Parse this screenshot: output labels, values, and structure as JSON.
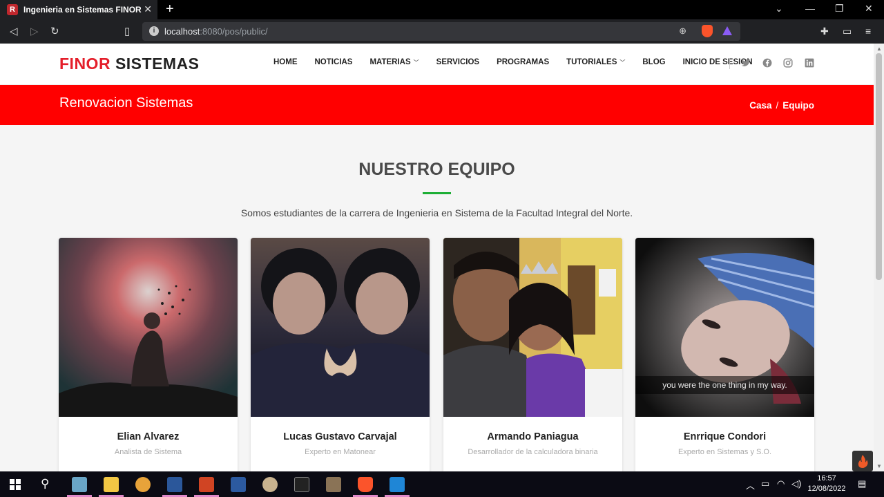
{
  "browser": {
    "tab_title": "Ingenieria en Sistemas FINOR",
    "tab_favicon_letter": "R",
    "url_host": "localhost",
    "url_rest": ":8080/pos/public/"
  },
  "site": {
    "logo_red": "FINOR",
    "logo_dark": "SISTEMAS",
    "menu": [
      {
        "label": "HOME",
        "dropdown": false
      },
      {
        "label": "NOTICIAS",
        "dropdown": false
      },
      {
        "label": "MATERIAS",
        "dropdown": true
      },
      {
        "label": "SERVICIOS",
        "dropdown": false
      },
      {
        "label": "PROGRAMAS",
        "dropdown": false
      },
      {
        "label": "TUTORIALES",
        "dropdown": true
      },
      {
        "label": "BLOG",
        "dropdown": false
      },
      {
        "label": "INICIO DE SESION",
        "dropdown": false
      }
    ],
    "social_icons": [
      "twitter-icon",
      "facebook-icon",
      "instagram-icon",
      "linkedin-icon"
    ],
    "hero_title": "Renovacion Sistemas",
    "breadcrumb": {
      "home": "Casa",
      "separator": "/",
      "current": "Equipo"
    },
    "section_title": "NUESTRO EQUIPO",
    "section_description": "Somos estudiantes de la carrera de Ingenieria en Sistema de la Facultad Integral del Norte.",
    "team": [
      {
        "name": "Elian Alvarez",
        "role": "Analista de Sistema"
      },
      {
        "name": "Lucas Gustavo Carvajal",
        "role": "Experto en Matonear"
      },
      {
        "name": "Armando Paniagua",
        "role": "Desarrollador de la calculadora binaria"
      },
      {
        "name": "Enrrique Condori",
        "role": "Experto en Sistemas y S.O.",
        "photo_caption": "you were the one thing in my way."
      }
    ],
    "colors": {
      "brand_red": "#ff0000",
      "logo_red": "#e41e2a",
      "accent_green": "#1cae34"
    }
  },
  "taskbar": {
    "time": "16:57",
    "date": "12/08/2022"
  }
}
